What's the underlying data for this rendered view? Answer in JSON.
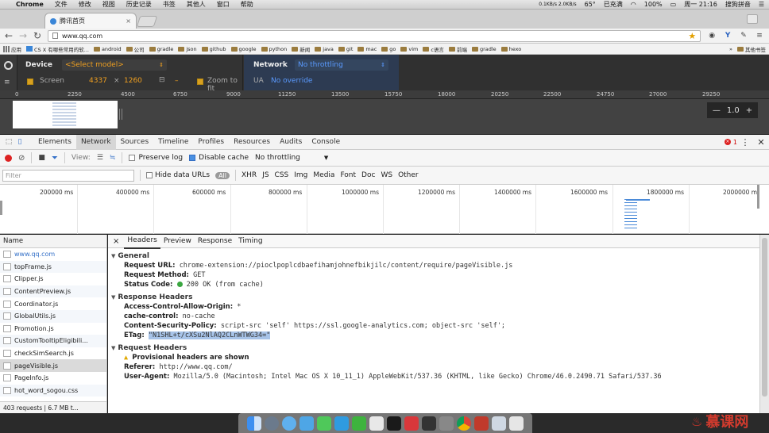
{
  "menubar": {
    "app": "Chrome",
    "items": [
      "文件",
      "修改",
      "视图",
      "历史记录",
      "书签",
      "其他人",
      "窗口",
      "帮助"
    ],
    "status": {
      "net_speed": "0.1KB/s 2.0KB/s",
      "temp": "65°",
      "charge": "已充满",
      "battery": "100%",
      "clock": "周一 21:16",
      "search": "搜狗拼音"
    }
  },
  "tab": {
    "title": "腾讯首页",
    "close": "×"
  },
  "toolbar": {
    "url": "www.qq.com"
  },
  "bookmarks": {
    "apps": "应用",
    "items": [
      "CS X 有哪些常用的软...",
      "android",
      "公司",
      "gradle",
      "json",
      "github",
      "google",
      "python",
      "新闻",
      "java",
      "git",
      "mac",
      "go",
      "vim",
      "c语言",
      "前端",
      "gradle",
      "hexo"
    ],
    "overflow": "»",
    "other": "其他书签"
  },
  "device": {
    "label": "Device",
    "model": "<Select model>",
    "screen_label": "Screen",
    "width": "4337",
    "x": "×",
    "height": "1260",
    "dash": "–",
    "zoom_label": "Zoom to fit",
    "network_label": "Network",
    "throttle": "No throttling",
    "ua_label": "UA",
    "ua_value": "No override"
  },
  "ruler": {
    "ticks": [
      "0",
      "2250",
      "4500",
      "6750",
      "9000",
      "11250",
      "13500",
      "15750",
      "18000",
      "20250",
      "22500",
      "24750",
      "27000",
      "29250"
    ]
  },
  "zoom": {
    "minus": "—",
    "value": "1.0",
    "plus": "+"
  },
  "devtools": {
    "tabs": [
      "Elements",
      "Network",
      "Sources",
      "Timeline",
      "Profiles",
      "Resources",
      "Audits",
      "Console"
    ],
    "active_tab": "Network",
    "error_count": "1"
  },
  "network_toolbar": {
    "view_label": "View:",
    "preserve_log": "Preserve log",
    "disable_cache": "Disable cache",
    "throttle": "No throttling"
  },
  "filter": {
    "placeholder": "Filter",
    "hide_data_urls": "Hide data URLs",
    "types": [
      "All",
      "XHR",
      "JS",
      "CSS",
      "Img",
      "Media",
      "Font",
      "Doc",
      "WS",
      "Other"
    ]
  },
  "overview": {
    "labels": [
      "200000 ms",
      "400000 ms",
      "600000 ms",
      "800000 ms",
      "1000000 ms",
      "1200000 ms",
      "1400000 ms",
      "1600000 ms",
      "1800000 ms",
      "2000000 m"
    ]
  },
  "requests": {
    "header": "Name",
    "items": [
      "www.qq.com",
      "topFrame.js",
      "Clipper.js",
      "ContentPreview.js",
      "Coordinator.js",
      "GlobalUtils.js",
      "Promotion.js",
      "CustomTooltipEligibili...",
      "checkSimSearch.js",
      "pageVisible.js",
      "PageInfo.js",
      "hot_word_sogou.css"
    ],
    "selected": "pageVisible.js",
    "status": "403 requests | 6.7 MB t..."
  },
  "details": {
    "close": "×",
    "tabs": [
      "Headers",
      "Preview",
      "Response",
      "Timing"
    ],
    "general": {
      "title": "General",
      "request_url_k": "Request URL:",
      "request_url_v": "chrome-extension://pioclpoplcdbaefihamjohnefbikjilc/content/require/pageVisible.js",
      "method_k": "Request Method:",
      "method_v": "GET",
      "status_k": "Status Code:",
      "status_v": "200 OK (from cache)"
    },
    "response": {
      "title": "Response Headers",
      "acao_k": "Access-Control-Allow-Origin:",
      "acao_v": "*",
      "cc_k": "cache-control:",
      "cc_v": "no-cache",
      "csp_k": "Content-Security-Policy:",
      "csp_v": "script-src 'self' https://ssl.google-analytics.com; object-src 'self';",
      "etag_k": "ETag:",
      "etag_v": "\"N1SHL+t/cXSu2NlAQ2CLnWTWG34=\""
    },
    "request": {
      "title": "Request Headers",
      "provisional": "Provisional headers are shown",
      "referer_k": "Referer:",
      "referer_v": "http://www.qq.com/",
      "ua_k": "User-Agent:",
      "ua_v": "Mozilla/5.0 (Macintosh; Intel Mac OS X 10_11_1) AppleWebKit/537.36 (KHTML, like Gecko) Chrome/46.0.2490.71 Safari/537.36"
    }
  },
  "watermark": {
    "text": "慕课网"
  },
  "colors": {
    "accent_blue": "#3470c8",
    "device_orange": "#f0a020",
    "record_red": "#dd2222",
    "status_green": "#3aa640"
  }
}
